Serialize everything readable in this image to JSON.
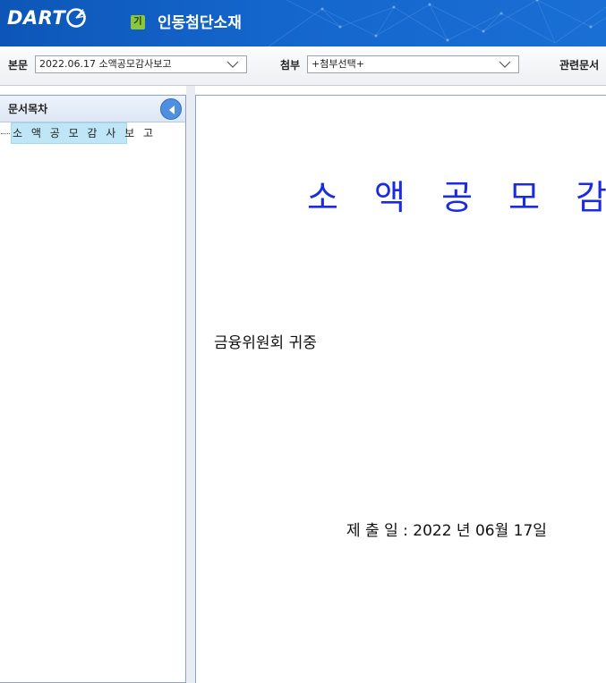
{
  "header": {
    "logo_text": "DART",
    "corp_badge": "기",
    "company_name": "인동첨단소재"
  },
  "selectors": {
    "main_label": "본문",
    "main_value": "2022.06.17  소액공모감사보고",
    "attach_label": "첨부",
    "attach_value": "+첨부선택+",
    "related_label": "관련문서"
  },
  "toc": {
    "title": "문서목차",
    "items": [
      {
        "label": "소 액 공 모 감 사 보 고"
      }
    ]
  },
  "document": {
    "title": "소 액 공 모 감 사 보",
    "recipient": "금융위원회 귀중",
    "submit_date": "제 출 일 : 2022 년 06월 17일"
  },
  "colors": {
    "header_blue": "#1466cc",
    "title_blue": "#1a2be0",
    "toc_highlight": "#bfe6f6",
    "badge_green": "#8cc63f"
  }
}
